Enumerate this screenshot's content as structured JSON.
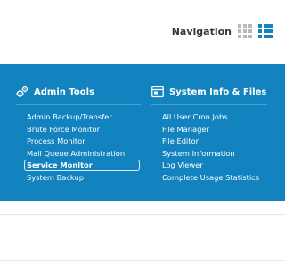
{
  "header": {
    "navigation_label": "Navigation",
    "grid_view_icon": "grid-icon",
    "list_view_icon": "list-icon",
    "active_view": "list"
  },
  "colors": {
    "panel_bg": "#1283bf",
    "active_view_icon": "#1283bf",
    "inactive_view_icon": "#b5b9bd",
    "link_text": "#ffffff"
  },
  "sections": [
    {
      "title": "Admin Tools",
      "icon": "gears-icon",
      "items": [
        {
          "label": "Admin Backup/Transfer"
        },
        {
          "label": "Brute Force Monitor"
        },
        {
          "label": "Process Monitor"
        },
        {
          "label": "Mail Queue Administration"
        },
        {
          "label": "Service Monitor",
          "active": true
        },
        {
          "label": "System Backup"
        }
      ]
    },
    {
      "title": "System Info & Files",
      "icon": "browser-window-icon",
      "items": [
        {
          "label": "All User Cron Jobs"
        },
        {
          "label": "File Manager"
        },
        {
          "label": "File Editor"
        },
        {
          "label": "System Information"
        },
        {
          "label": "Log Viewer"
        },
        {
          "label": "Complete Usage Statistics"
        }
      ]
    }
  ]
}
